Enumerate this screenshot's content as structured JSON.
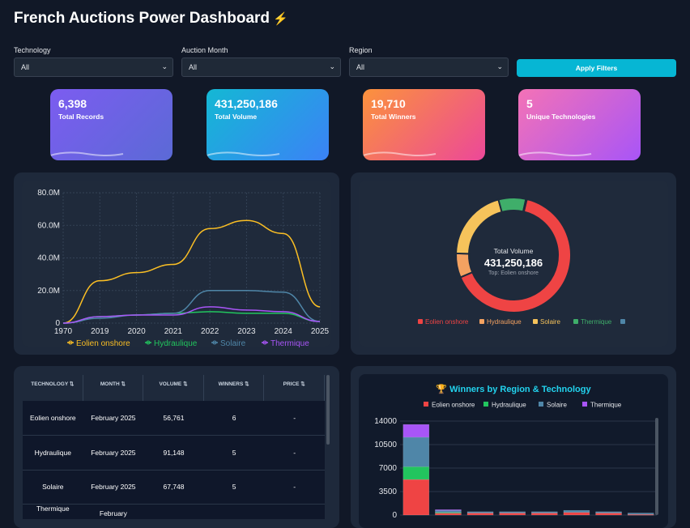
{
  "header": {
    "title": "French Auctions Power Dashboard",
    "icon": "lightning-icon"
  },
  "filters": [
    {
      "label": "Technology",
      "value": "All"
    },
    {
      "label": "Auction Month",
      "value": "All"
    },
    {
      "label": "Region",
      "value": "All"
    }
  ],
  "apply_label": "Apply Filters",
  "kpis": [
    {
      "value": "6,398",
      "label": "Total Records"
    },
    {
      "value": "431,250,186",
      "label": "Total Volume"
    },
    {
      "value": "19,710",
      "label": "Total Winners"
    },
    {
      "value": "5",
      "label": "Unique Technologies"
    }
  ],
  "donut": {
    "title": "Total Volume",
    "value": "431,250,186",
    "sub": "Top: Eolien onshore"
  },
  "table": {
    "headers": [
      "TECHNOLOGY ⇅",
      "MONTH ⇅",
      "VOLUME ⇅",
      "WINNERS ⇅",
      "PRICE ⇅"
    ],
    "rows": [
      [
        "Eolien onshore",
        "February 2025",
        "56,761",
        "6",
        "-"
      ],
      [
        "Hydraulique",
        "February 2025",
        "91,148",
        "5",
        "-"
      ],
      [
        "Solaire",
        "February 2025",
        "67,748",
        "5",
        "-"
      ],
      [
        "Thermique",
        "February",
        "",
        "",
        ""
      ]
    ]
  },
  "bar_title": "🏆 Winners by Region & Technology",
  "colors": {
    "eolien": "#ef4444",
    "hydraulique": "#22c55e",
    "solaire": "#3b82f6",
    "thermique": "#a855f7",
    "line_eolien": "#fbbf24",
    "line_hydro": "#22c55e",
    "line_solaire": "#4f86a8",
    "line_thermique": "#a855f7"
  },
  "chart_data": [
    {
      "type": "line",
      "x": [
        "1970",
        "2019",
        "2020",
        "2021",
        "2022",
        "2023",
        "2024",
        "2025"
      ],
      "yticks": [
        "0",
        "20.0M",
        "40.0M",
        "60.0M",
        "80.0M"
      ],
      "ylim": [
        0,
        80
      ],
      "series": [
        {
          "name": "Eolien onshore",
          "values": [
            0,
            26,
            31,
            36,
            58,
            63,
            55,
            10
          ]
        },
        {
          "name": "Hydraulique",
          "values": [
            0,
            4,
            5,
            6,
            7,
            6,
            6,
            1
          ]
        },
        {
          "name": "Solaire",
          "values": [
            0,
            3,
            5,
            6,
            20,
            20,
            19,
            1
          ]
        },
        {
          "name": "Thermique",
          "values": [
            0,
            4,
            5,
            5,
            10,
            8,
            7,
            1
          ]
        }
      ],
      "legend": "bottom"
    },
    {
      "type": "pie",
      "categories": [
        "Eolien onshore",
        "Hydraulique",
        "Solaire",
        "Thermique",
        ""
      ],
      "values": [
        278,
        29,
        87,
        33,
        1
      ],
      "legend": "bottom"
    },
    {
      "type": "bar",
      "stacked": true,
      "yticks": [
        "0",
        "3500",
        "7000",
        "10500",
        "14000"
      ],
      "ylim": [
        0,
        14000
      ],
      "series": [
        {
          "name": "Eolien onshore",
          "values": [
            5300,
            300,
            300,
            300,
            300,
            400,
            300,
            100
          ]
        },
        {
          "name": "Hydraulique",
          "values": [
            1900,
            100,
            0,
            0,
            0,
            0,
            0,
            0
          ]
        },
        {
          "name": "Solaire",
          "values": [
            4400,
            300,
            200,
            200,
            200,
            300,
            200,
            200
          ]
        },
        {
          "name": "Thermique",
          "values": [
            1900,
            100,
            0,
            0,
            0,
            0,
            0,
            0
          ]
        }
      ],
      "legend": "top"
    }
  ]
}
